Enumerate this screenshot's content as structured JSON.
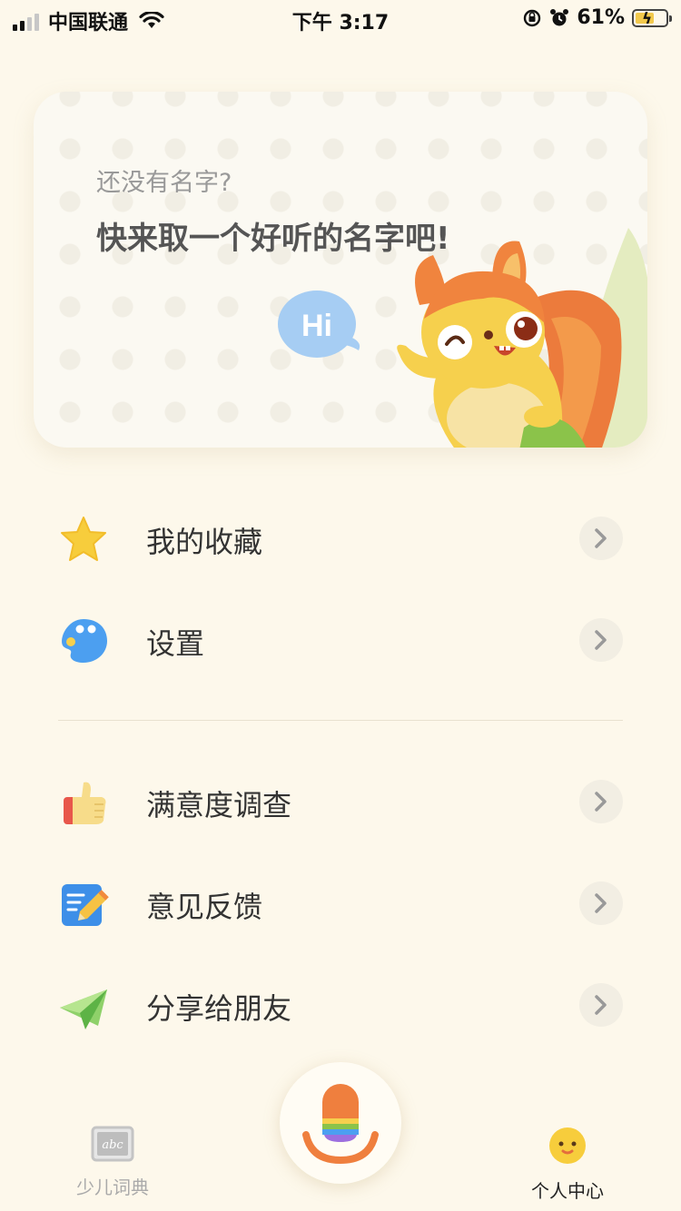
{
  "status_bar": {
    "carrier": "中国联通",
    "time": "下午 3:17",
    "battery_percent": "61%",
    "battery_level": 0.61
  },
  "profile_card": {
    "subtitle": "还没有名字?",
    "headline": "快来取一个好听的名字吧!",
    "bubble_text": "Hi"
  },
  "menu": {
    "items": [
      {
        "label": "我的收藏",
        "icon": "star-icon"
      },
      {
        "label": "设置",
        "icon": "palette-icon"
      },
      {
        "label": "满意度调查",
        "icon": "thumbs-up-icon"
      },
      {
        "label": "意见反馈",
        "icon": "feedback-pencil-icon"
      },
      {
        "label": "分享给朋友",
        "icon": "paper-plane-icon"
      }
    ]
  },
  "tab_bar": {
    "dictionary_label": "少儿词典",
    "dictionary_icon_text": "abc",
    "profile_label": "个人中心"
  },
  "colors": {
    "background": "#fdf8eb",
    "mic_orange": "#ef7f3e"
  }
}
